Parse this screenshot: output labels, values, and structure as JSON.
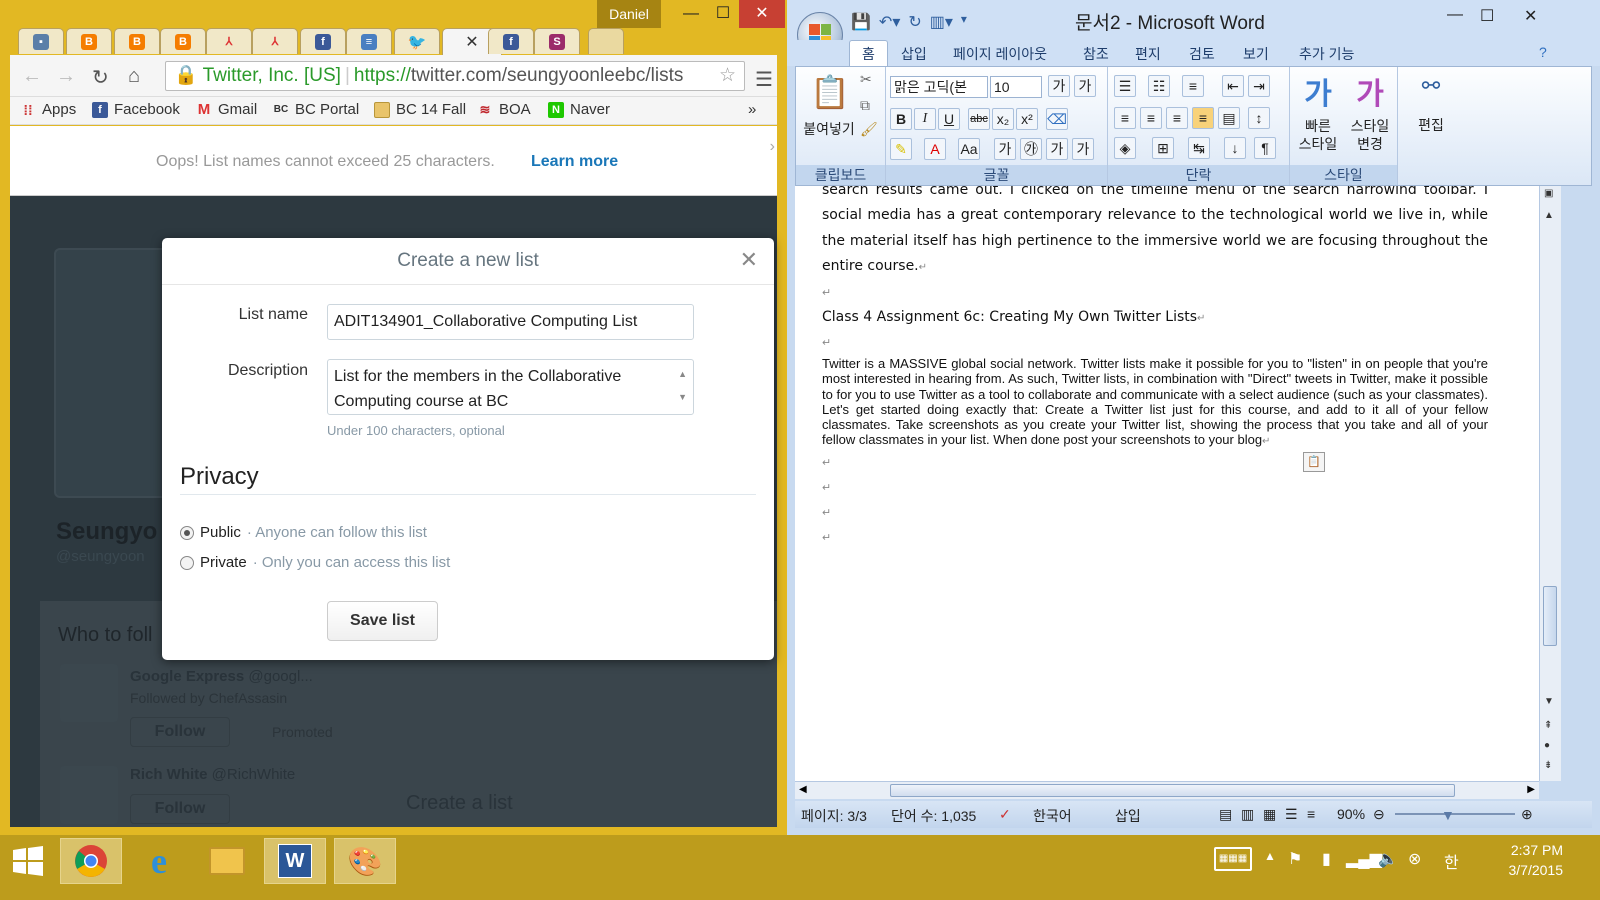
{
  "chrome": {
    "user": "Daniel",
    "tabs": [
      {
        "icon": "blogger-icon",
        "color": "#5b7fa8"
      },
      {
        "icon": "blogger-icon",
        "color": "#f57d00"
      },
      {
        "icon": "blogger-icon",
        "color": "#f57d00"
      },
      {
        "icon": "blogger-icon",
        "color": "#f57d00"
      },
      {
        "icon": "pdf-icon",
        "color": "#d33"
      },
      {
        "icon": "pdf-icon",
        "color": "#d33"
      },
      {
        "icon": "facebook-icon",
        "color": "#3b5998"
      },
      {
        "icon": "docs-icon",
        "color": "#4a7fc1"
      },
      {
        "icon": "twitter-icon",
        "color": "#55acee"
      },
      {
        "icon": "close-icon",
        "color": "#333"
      },
      {
        "icon": "facebook-icon",
        "color": "#3b5998"
      },
      {
        "icon": "skype-icon",
        "color": "#9b2b6a"
      }
    ],
    "address": {
      "org": "Twitter, Inc. [US]",
      "scheme": "https://",
      "rest": "twitter.com/seungyoonleebc/lists"
    },
    "bookmarks": [
      "Apps",
      "Facebook",
      "Gmail",
      "BC Portal",
      "BC 14 Fall",
      "BOA",
      "Naver"
    ],
    "bookmark_overflow": "»",
    "infobar": {
      "message": "Oops! List names cannot exceed 25 characters.",
      "link": "Learn more"
    },
    "background": {
      "name": "Seungyo",
      "handle": "@seungyoon",
      "who_to_follow": "Who to foll",
      "row1_name": "Google Express",
      "row1_handle": "@googl...",
      "row1_sub": "Followed by ChefAssasin",
      "row1_follow": "Follow",
      "row1_promoted": "Promoted",
      "row2_name": "Rich White",
      "row2_handle": "@RichWhite",
      "row2_follow": "Follow",
      "create_list": "Create a list"
    },
    "modal": {
      "title": "Create a new list",
      "list_name_label": "List name",
      "list_name_value": "ADIT134901_Collaborative Computing List",
      "description_label": "Description",
      "description_value": "List for the members in the Collaborative Computing course at BC",
      "hint": "Under 100 characters, optional",
      "privacy_title": "Privacy",
      "public_label": "Public",
      "public_desc": "· Anyone can follow this list",
      "private_label": "Private",
      "private_desc": "· Only you can access this list",
      "save": "Save list"
    }
  },
  "word": {
    "title": "문서2 - Microsoft Word",
    "tabs": [
      "홈",
      "삽입",
      "페이지 레이아웃",
      "참조",
      "편지",
      "검토",
      "보기",
      "추가 기능"
    ],
    "groups": {
      "clipboard": "클립보드",
      "paste": "붙여넣기",
      "font": "글꼴",
      "font_name": "맑은 고딕(본",
      "font_size": "10",
      "paragraph": "단락",
      "styles": "스타일",
      "quick_styles": "빠른\n스타일",
      "change_styles": "스타일\n변경",
      "quick_styles_1": "빠른",
      "quick_styles_2": "스타일",
      "change_styles_1": "스타일",
      "change_styles_2": "변경",
      "editing": "편집"
    },
    "doc": {
      "cut_line": "search results came out, I clicked on the timeline menu of the search narrowing toolbar. I believe",
      "para1": "social media has a great contemporary relevance to the technological world we live in, while the material itself has high pertinence to the immersive world we are focusing throughout the entire course.",
      "heading": "Class 4 Assignment 6c: Creating My Own Twitter Lists",
      "para2": "Twitter is a MASSIVE global social network. Twitter lists make it possible for you to \"listen\" in on people that you're most interested in hearing from. As such, Twitter lists, in combination with \"Direct\" tweets in Twitter, make it possible to for you to use Twitter as a tool to collaborate and communicate with a select audience (such as your classmates). Let's get started doing exactly that: Create a Twitter list just for this course, and add to it all of your fellow classmates. Take screenshots as you create your Twitter list, showing the process that you take and all of your fellow classmates in your list. When done post your screenshots to your blog"
    },
    "status": {
      "page": "페이지: 3/3",
      "words": "단어 수: 1,035",
      "lang": "한국어",
      "mode": "삽입",
      "zoom": "90%"
    }
  },
  "taskbar": {
    "time": "2:37 PM",
    "date": "3/7/2015",
    "ime": "한"
  }
}
